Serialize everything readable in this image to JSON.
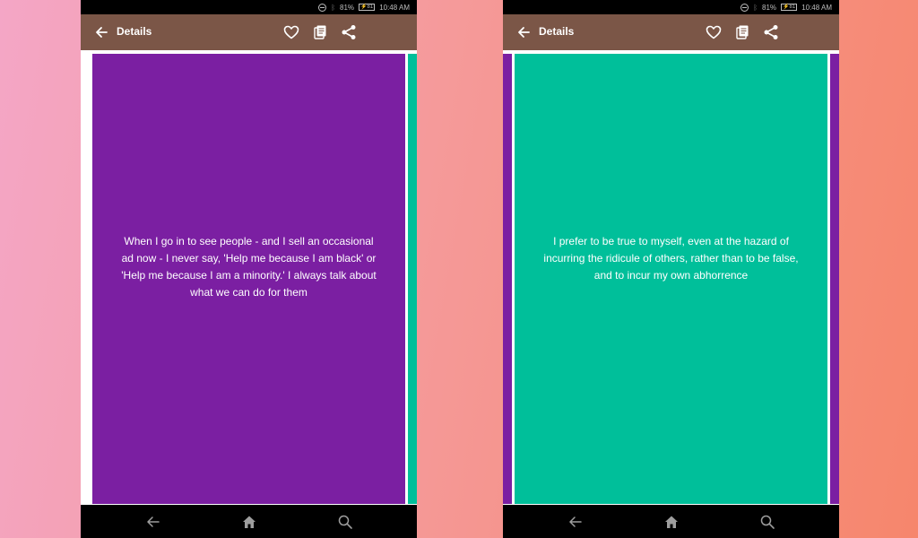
{
  "status_bar": {
    "battery_percent": "81%",
    "battery_badge": "⚡81",
    "time": "10:48 AM"
  },
  "app_bar": {
    "title": "Details"
  },
  "colors": {
    "app_bar": "#7b5647",
    "purple_card": "#7b1fa2",
    "teal_card": "#00bf9a"
  },
  "icons": {
    "back": "arrow-left-icon",
    "favorite": "heart-outline-icon",
    "copy": "copy-icon",
    "share": "share-icon",
    "nav_back": "nav-back-icon",
    "nav_home": "home-icon",
    "nav_search": "search-icon"
  },
  "left_screen": {
    "quote": "When I go in to see people - and I sell an occasional ad now - I never say, 'Help me because I am black' or 'Help me because I am a minority.' I always talk about what we can do for them"
  },
  "right_screen": {
    "quote": "I prefer to be true to myself, even at the hazard of incurring the ridicule of others, rather than to be false, and to incur my own abhorrence"
  }
}
